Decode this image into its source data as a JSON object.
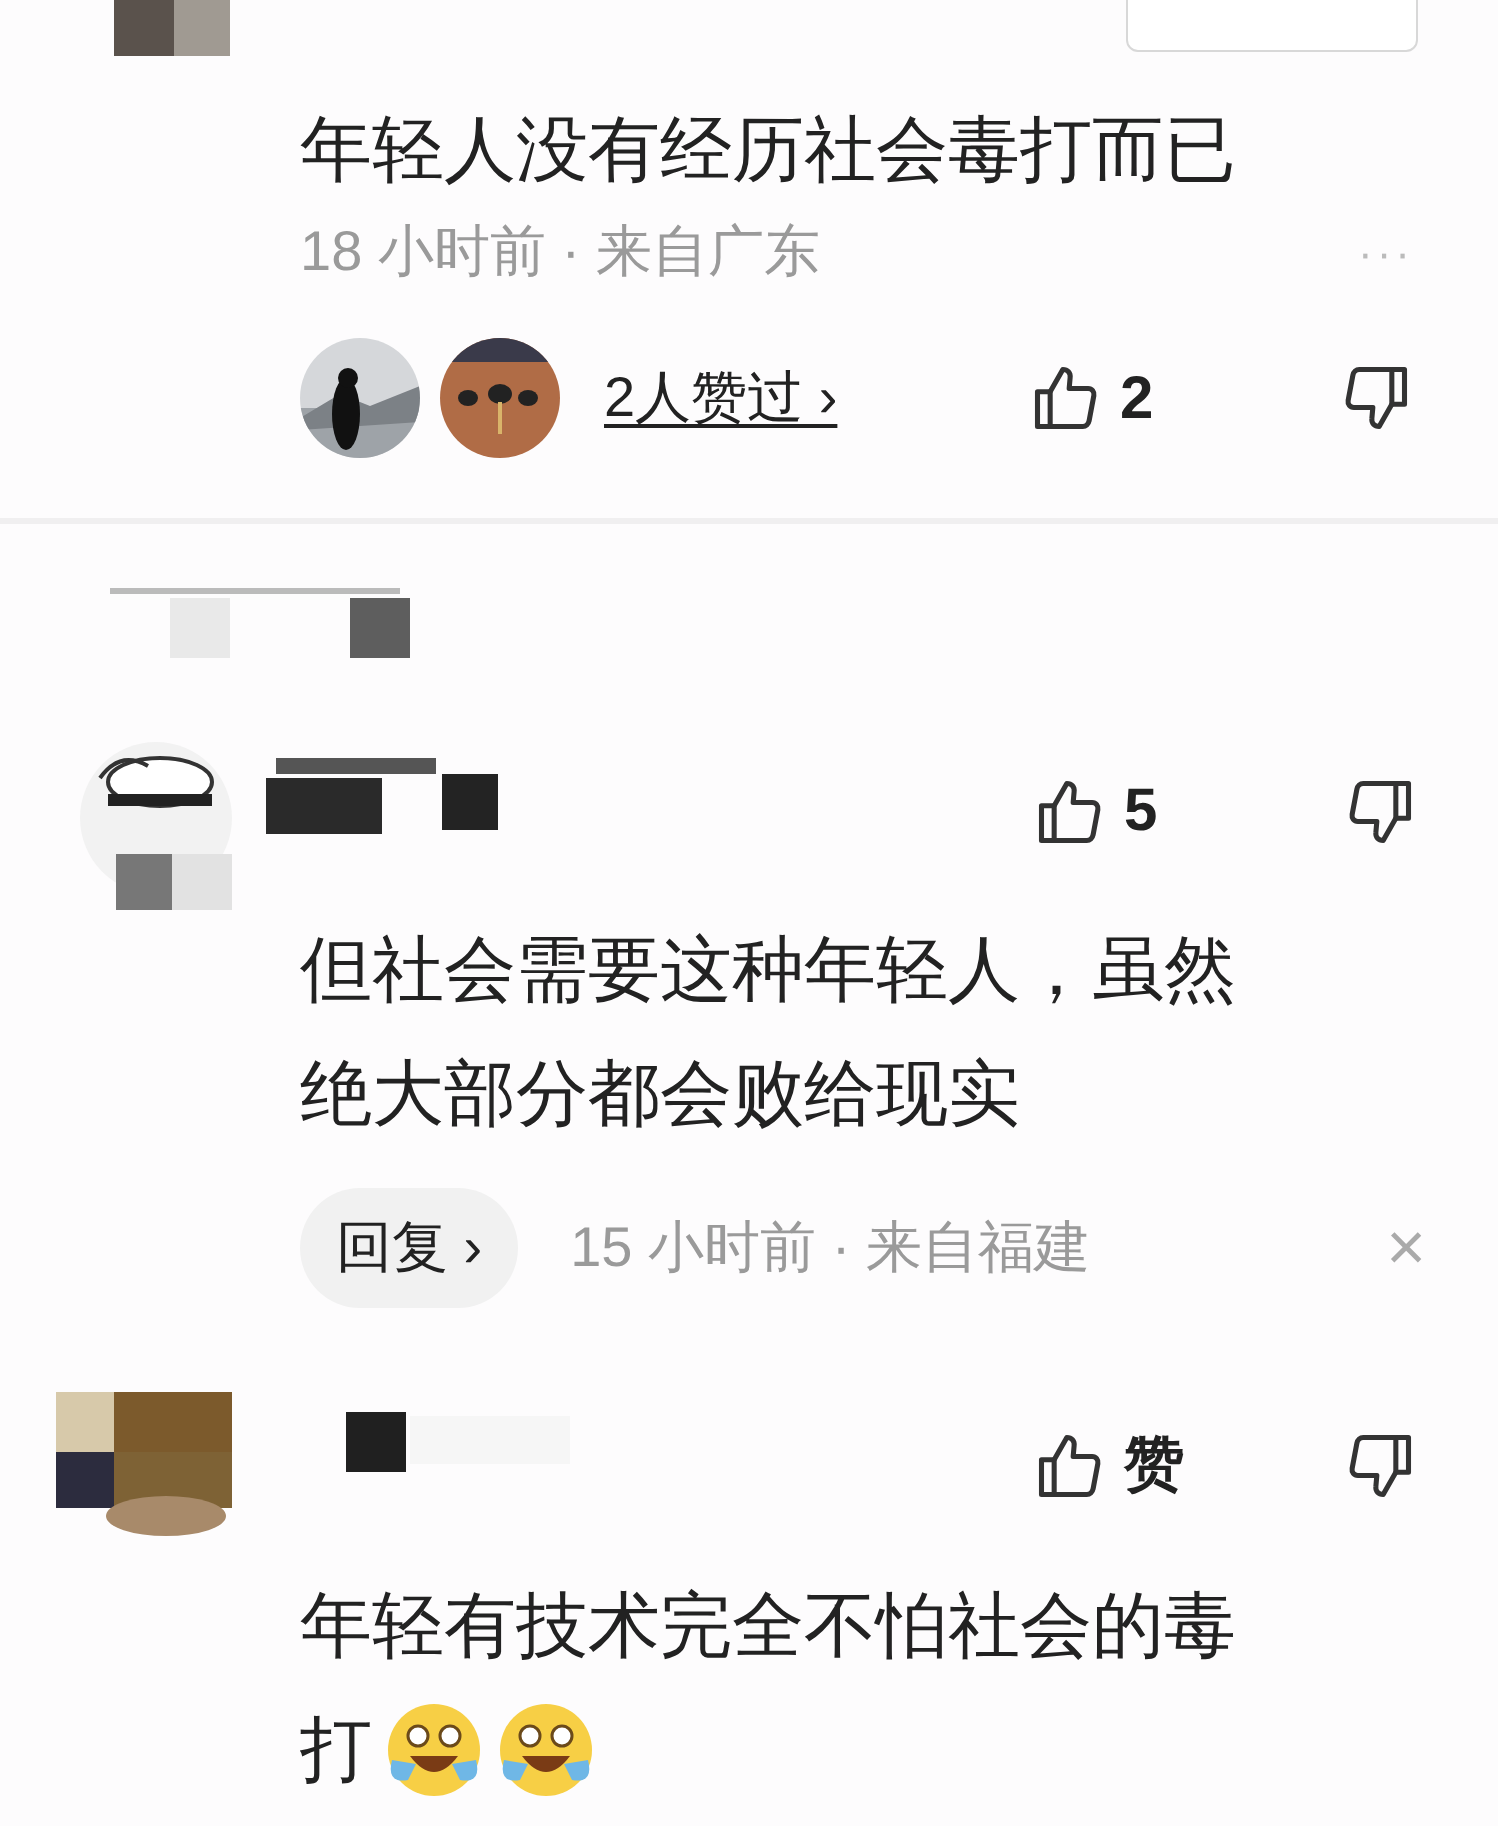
{
  "top_comment": {
    "text": "年轻人没有经历社会毒打而已",
    "meta": "18 小时前 · 来自广东",
    "more": "···",
    "likers_link": "2人赞过 ›",
    "likes": "2"
  },
  "comments": [
    {
      "likes": "5",
      "lines": [
        "但社会需要这种年轻人，虽然",
        "绝大部分都会败给现实"
      ],
      "reply_button": "回复 ›",
      "meta": "15 小时前 · 来自福建",
      "close": "×"
    },
    {
      "likes": "赞",
      "lines": [
        "年轻有技术完全不怕社会的毒",
        "打"
      ],
      "emojis": [
        {
          "kind": "tears_of_joy"
        },
        {
          "kind": "tears_of_joy"
        }
      ]
    }
  ]
}
